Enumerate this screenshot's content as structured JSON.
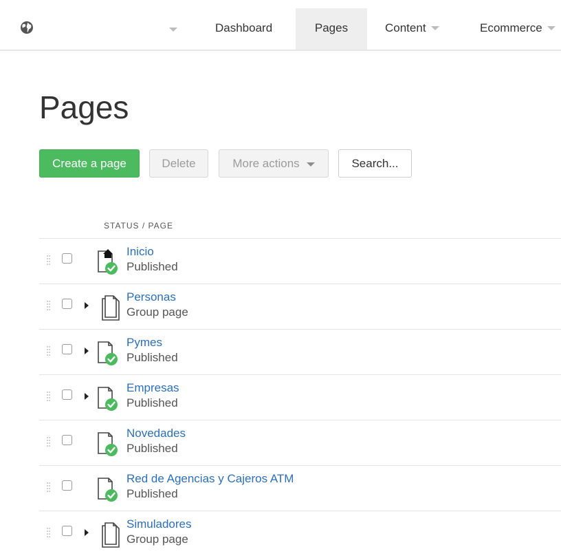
{
  "nav": {
    "items": [
      {
        "label": "Dashboard"
      },
      {
        "label": "Pages"
      },
      {
        "label": "Content"
      },
      {
        "label": "Ecommerce"
      }
    ]
  },
  "page": {
    "title": "Pages"
  },
  "toolbar": {
    "create_label": "Create a page",
    "delete_label": "Delete",
    "more_label": "More actions",
    "search_label": "Search..."
  },
  "table": {
    "column_header": "STATUS / PAGE",
    "rows": [
      {
        "name": "Inicio",
        "status": "Published",
        "icon": "home-published-page-icon",
        "expandable": false
      },
      {
        "name": "Personas",
        "status": "Group page",
        "icon": "group-page-icon",
        "expandable": true
      },
      {
        "name": "Pymes",
        "status": "Published",
        "icon": "published-page-icon",
        "expandable": true
      },
      {
        "name": "Empresas",
        "status": "Published",
        "icon": "published-page-icon",
        "expandable": true
      },
      {
        "name": "Novedades",
        "status": "Published",
        "icon": "published-page-icon",
        "expandable": false
      },
      {
        "name": "Red de Agencias y Cajeros ATM",
        "status": "Published",
        "icon": "published-page-icon",
        "expandable": false
      },
      {
        "name": "Simuladores",
        "status": "Group page",
        "icon": "group-page-icon",
        "expandable": true
      }
    ]
  },
  "colors": {
    "accent_green": "#4cba5f",
    "link_blue": "#2c6fb8",
    "active_tab_bg": "#eeeeee"
  }
}
